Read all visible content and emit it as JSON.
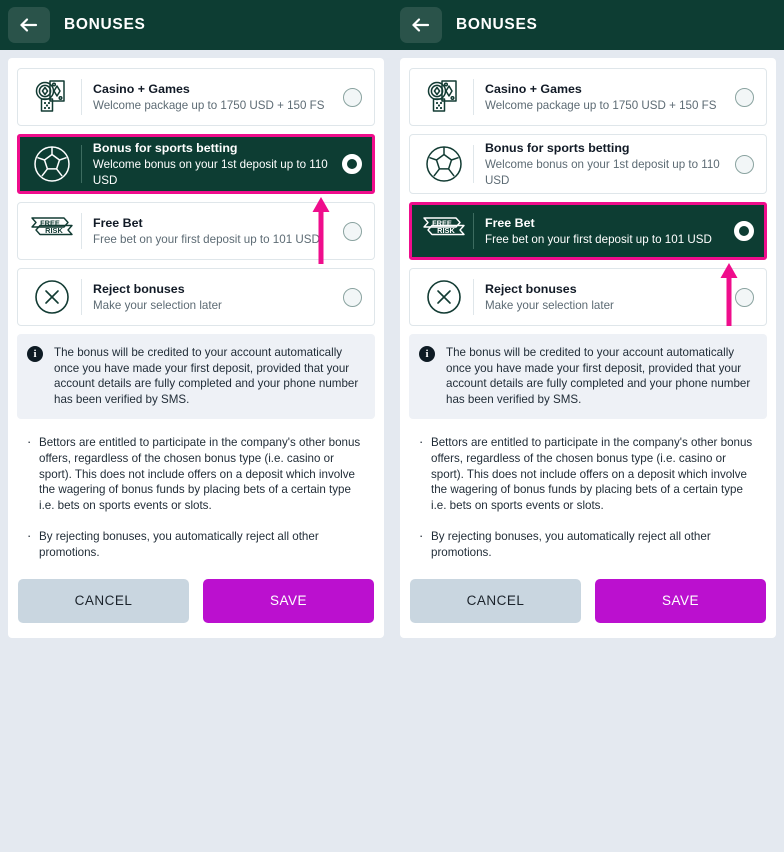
{
  "header": {
    "title": "BONUSES",
    "back_icon": "arrow-left-icon"
  },
  "options": [
    {
      "id": "casino-games",
      "icon": "casino-chips-cards-icon",
      "title": "Casino + Games",
      "subtitle": "Welcome package up to 1750 USD + 150 FS"
    },
    {
      "id": "sports-betting",
      "icon": "soccer-ball-icon",
      "title": "Bonus for sports betting",
      "subtitle": "Welcome bonus on your 1st deposit up to 110 USD"
    },
    {
      "id": "free-bet",
      "icon": "free-risk-ribbon-icon",
      "title": "Free Bet",
      "subtitle": "Free bet on your first deposit up to 101 USD",
      "icon_label_top": "FREE",
      "icon_label_bottom": "RISK"
    },
    {
      "id": "reject-bonuses",
      "icon": "circle-x-icon",
      "title": "Reject bonuses",
      "subtitle": "Make your selection later"
    }
  ],
  "info": {
    "icon": "info-circle-icon",
    "text": "The bonus will be credited to your account automatically once you have made your first deposit, provided that your account details are fully completed and your phone number has been verified by SMS."
  },
  "bullets": [
    "Bettors are entitled to participate in the company's other bonus offers, regardless of the chosen bonus type (i.e. casino or sport). This does not include offers on a deposit which involve the wagering of bonus funds by placing bets of a certain type i.e. bets on sports events or slots.",
    "By rejecting bonuses, you automatically reject all other promotions."
  ],
  "footer": {
    "cancel_label": "CANCEL",
    "save_label": "SAVE"
  },
  "panels": {
    "left": {
      "selected_option_id": "sports-betting",
      "annotation_arrow": "up-arrow-annotation"
    },
    "right": {
      "selected_option_id": "free-bet",
      "annotation_arrow": "up-arrow-annotation"
    }
  },
  "colors": {
    "header_green": "#0d3d33",
    "accent_magenta": "#ef0d8c",
    "save_purple": "#bb10cf",
    "cancel_gray": "#c9d6e0",
    "page_bg": "#e4e9f0"
  }
}
